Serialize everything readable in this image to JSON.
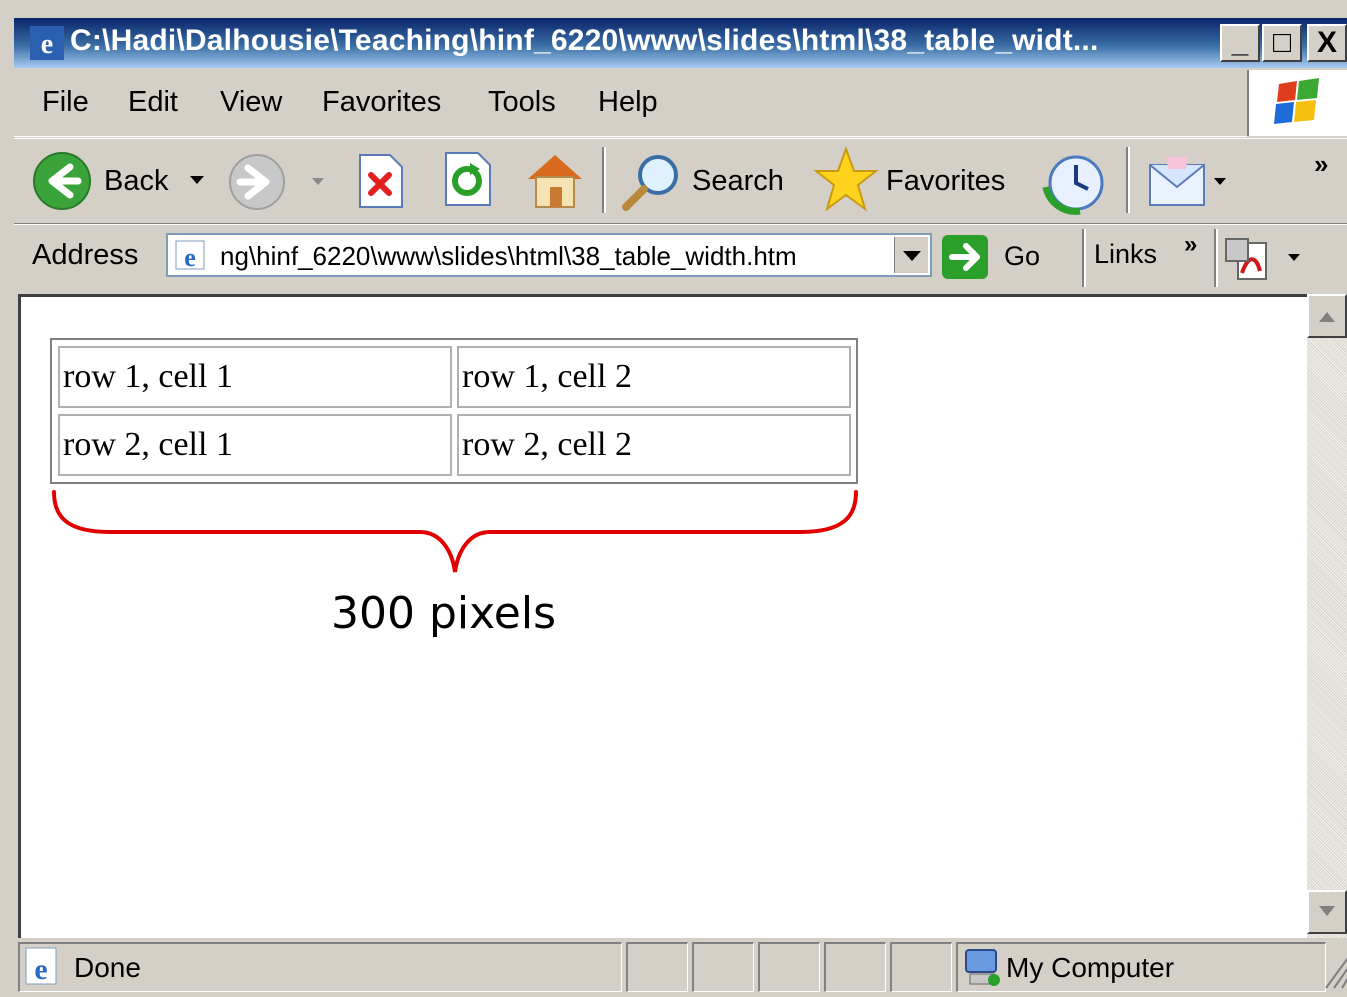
{
  "window": {
    "title": "C:\\Hadi\\Dalhousie\\Teaching\\hinf_6220\\www\\slides\\html\\38_table_widt..."
  },
  "title_buttons": {
    "minimize": "_",
    "maximize": "□",
    "close": "X"
  },
  "menu": [
    "File",
    "Edit",
    "View",
    "Favorites",
    "Tools",
    "Help"
  ],
  "toolbar": {
    "back": "Back",
    "search": "Search",
    "favorites": "Favorites",
    "chevron": "»"
  },
  "address": {
    "label": "Address",
    "value": "ng\\hinf_6220\\www\\slides\\html\\38_table_width.htm",
    "go": "Go",
    "links": "Links",
    "links_chevron": "»"
  },
  "table": {
    "rows": [
      [
        "row 1, cell 1",
        "row 1, cell 2"
      ],
      [
        "row 2, cell 1",
        "row 2, cell 2"
      ]
    ]
  },
  "annotation": {
    "text": "300 pixels",
    "color": "#e00000"
  },
  "status": {
    "left": "Done",
    "zone": "My Computer"
  }
}
